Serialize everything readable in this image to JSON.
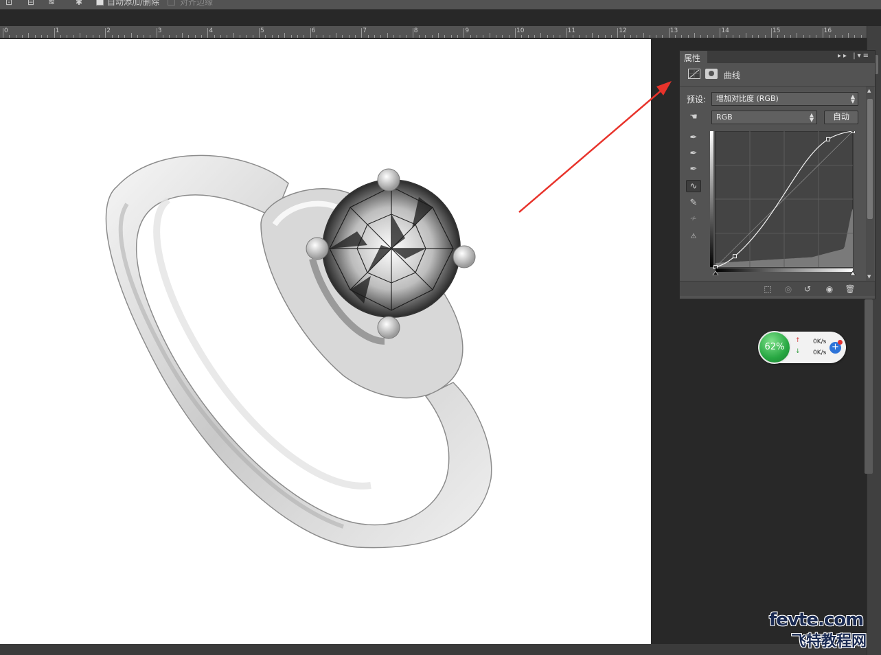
{
  "options_bar": {
    "auto_add_delete_label": "自动添加/删除",
    "align_edges_label": "对齐边缘"
  },
  "ruler": {
    "labels": [
      "0",
      "1",
      "2",
      "3",
      "4",
      "5",
      "6",
      "7",
      "8",
      "9",
      "10",
      "11",
      "12",
      "13",
      "14",
      "15",
      "16"
    ]
  },
  "properties_panel": {
    "tab_label": "属性",
    "adjustment_title": "曲线",
    "preset_label": "预设:",
    "preset_value": "增加对比度 (RGB)",
    "channel_value": "RGB",
    "auto_button": "自动",
    "curve_points": [
      [
        0,
        0
      ],
      [
        0.14,
        0.08
      ],
      [
        0.82,
        0.94
      ],
      [
        1,
        1
      ]
    ]
  },
  "net_widget": {
    "percent": "62%",
    "upload_speed": "0K/s",
    "download_speed": "0K/s",
    "plus_label": "+"
  },
  "watermark": {
    "line1": "fevte.com",
    "line2": "飞特教程网"
  },
  "colors": {
    "annotation_arrow": "#e8332b",
    "panel_bg": "#535353",
    "workspace_bg": "#282828"
  },
  "icons": [
    "curves-icon",
    "mask-icon",
    "hand-scrub-icon",
    "eyedropper-black-icon",
    "eyedropper-gray-icon",
    "eyedropper-white-icon",
    "curve-edit-icon",
    "pencil-icon",
    "smooth-icon",
    "clipping-warning-icon",
    "clip-to-layer-icon",
    "view-previous-icon",
    "reset-icon",
    "visibility-eye-icon",
    "trash-icon"
  ]
}
